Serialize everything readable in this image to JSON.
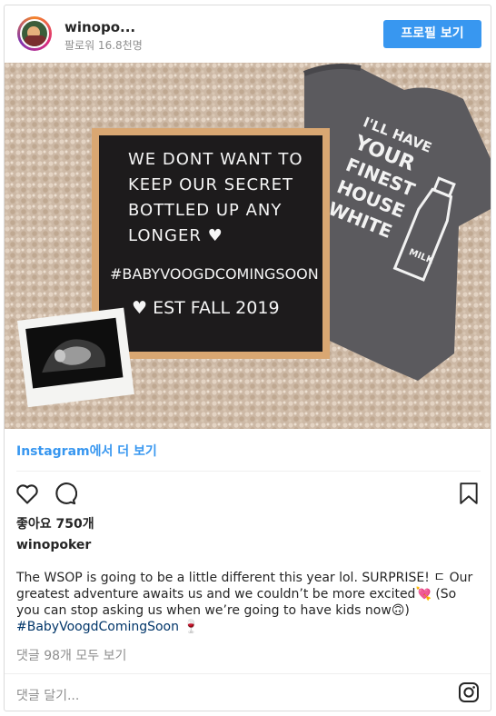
{
  "header": {
    "username": "winopo...",
    "followers": "팔로워 16.8천명",
    "profile_button": "프로필 보기"
  },
  "photo": {
    "letterboard_lines": [
      "WE DONT WANT TO",
      "KEEP OUR SECRET",
      "BOTTLED UP ANY",
      "LONGER ♥",
      "#BABYVOOGDCOMINGSOON",
      "♥ EST FALL 2019"
    ],
    "onesie_lines": [
      "I'LL HAVE",
      "YOUR",
      "FINEST",
      "HOUSE",
      "WHITE"
    ],
    "bottle_label": "MILK"
  },
  "view_on_instagram": "Instagram에서 더 보기",
  "likes": "좋아요 750개",
  "owner": "winopoker",
  "caption": {
    "text": "The WSOP is going to be a little different this year lol. SURPRISE! ㄷ Our greatest adventure awaits us and we couldn’t be more excited💘 (So you can stop asking us when we’re going to have kids now🙃)",
    "hashtag": "#BabyVoogdComingSoon",
    "trailing_emoji": "🍷"
  },
  "comments_link": "댓글 98개 모두 보기",
  "comment_placeholder": "댓글 달기...",
  "icons": [
    "heart-icon",
    "comment-icon",
    "bookmark-icon",
    "instagram-icon"
  ],
  "colors": {
    "accent": "#3897f0",
    "hashtag": "#003569",
    "muted": "#8e8e8e"
  }
}
